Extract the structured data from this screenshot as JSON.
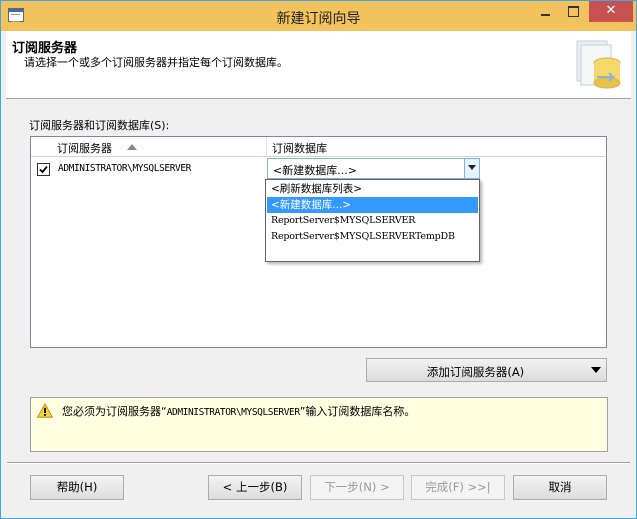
{
  "window": {
    "title": "新建订阅向导",
    "close_glyph": "✕"
  },
  "header": {
    "title": "订阅服务器",
    "subtitle": "请选择一个或多个订阅服务器并指定每个订阅数据库。"
  },
  "main": {
    "grid_label": "订阅服务器和订阅数据库(S):",
    "columns": [
      "订阅服务器",
      "订阅数据库"
    ],
    "rows": [
      {
        "checked": true,
        "server": "ADMINISTRATOR\\MYSQLSERVER",
        "database": "<新建数据库...>"
      }
    ],
    "dropdown_options": [
      "<刷新数据库列表>",
      "<新建数据库...>",
      "ReportServer$MYSQLSERVER",
      "ReportServer$MYSQLSERVERTempDB"
    ],
    "dropdown_selected_index": 1,
    "add_subscriber_label": "添加订阅服务器(A)"
  },
  "message": {
    "prefix": "您必须为订阅服务器“",
    "server": "ADMINISTRATOR\\MYSQLSERVER",
    "suffix": "”输入订阅数据库名称。",
    "icon": "warning-icon"
  },
  "footer": {
    "help": "帮助(H)",
    "back": "< 上一步(B)",
    "next": "下一步(N) >",
    "finish": "完成(F) >>|",
    "cancel": "取消"
  },
  "colors": {
    "titlebar": "#f2c35c",
    "selection": "#3399ff",
    "message_bg": "#ffffe1",
    "close_button": "#c75050"
  }
}
